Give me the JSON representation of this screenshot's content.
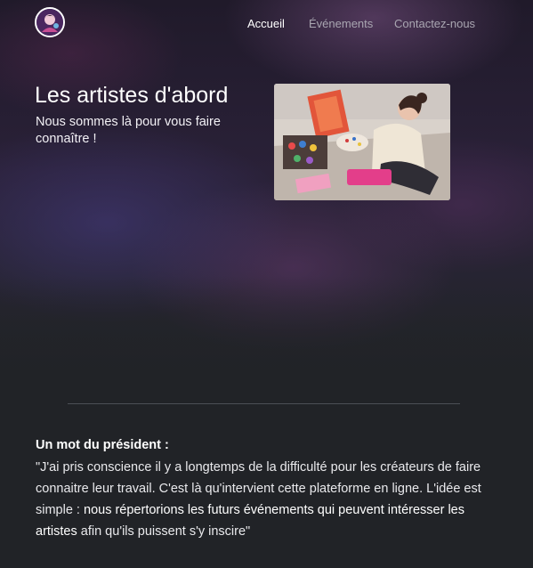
{
  "header": {
    "logo_icon": "artist-avatar-logo",
    "nav": [
      {
        "label": "Accueil",
        "active": true
      },
      {
        "label": "Événements",
        "active": false
      },
      {
        "label": "Contactez-nous",
        "active": false
      }
    ]
  },
  "hero": {
    "title": "Les artistes d'abord",
    "subtitle": "Nous sommes là pour vous faire connaître !",
    "image_icon": "painter-photo"
  },
  "president": {
    "title": "Un mot du président :",
    "quote_part1": "\"J'ai pris conscience il y a longtemps de la difficulté pour les créateurs de faire connaitre leur travail. C'est là qu'intervient cette plateforme en ligne. L'idée est simple : ",
    "quote_highlight": "nous répertorions les futurs événements qui peuvent intéresser les artistes",
    "quote_part2": " afin qu'ils puissent s'y inscire\""
  },
  "colors": {
    "background": "#212327",
    "nav_inactive": "#a9a6b1",
    "accent_purple": "#3b1e4a"
  }
}
